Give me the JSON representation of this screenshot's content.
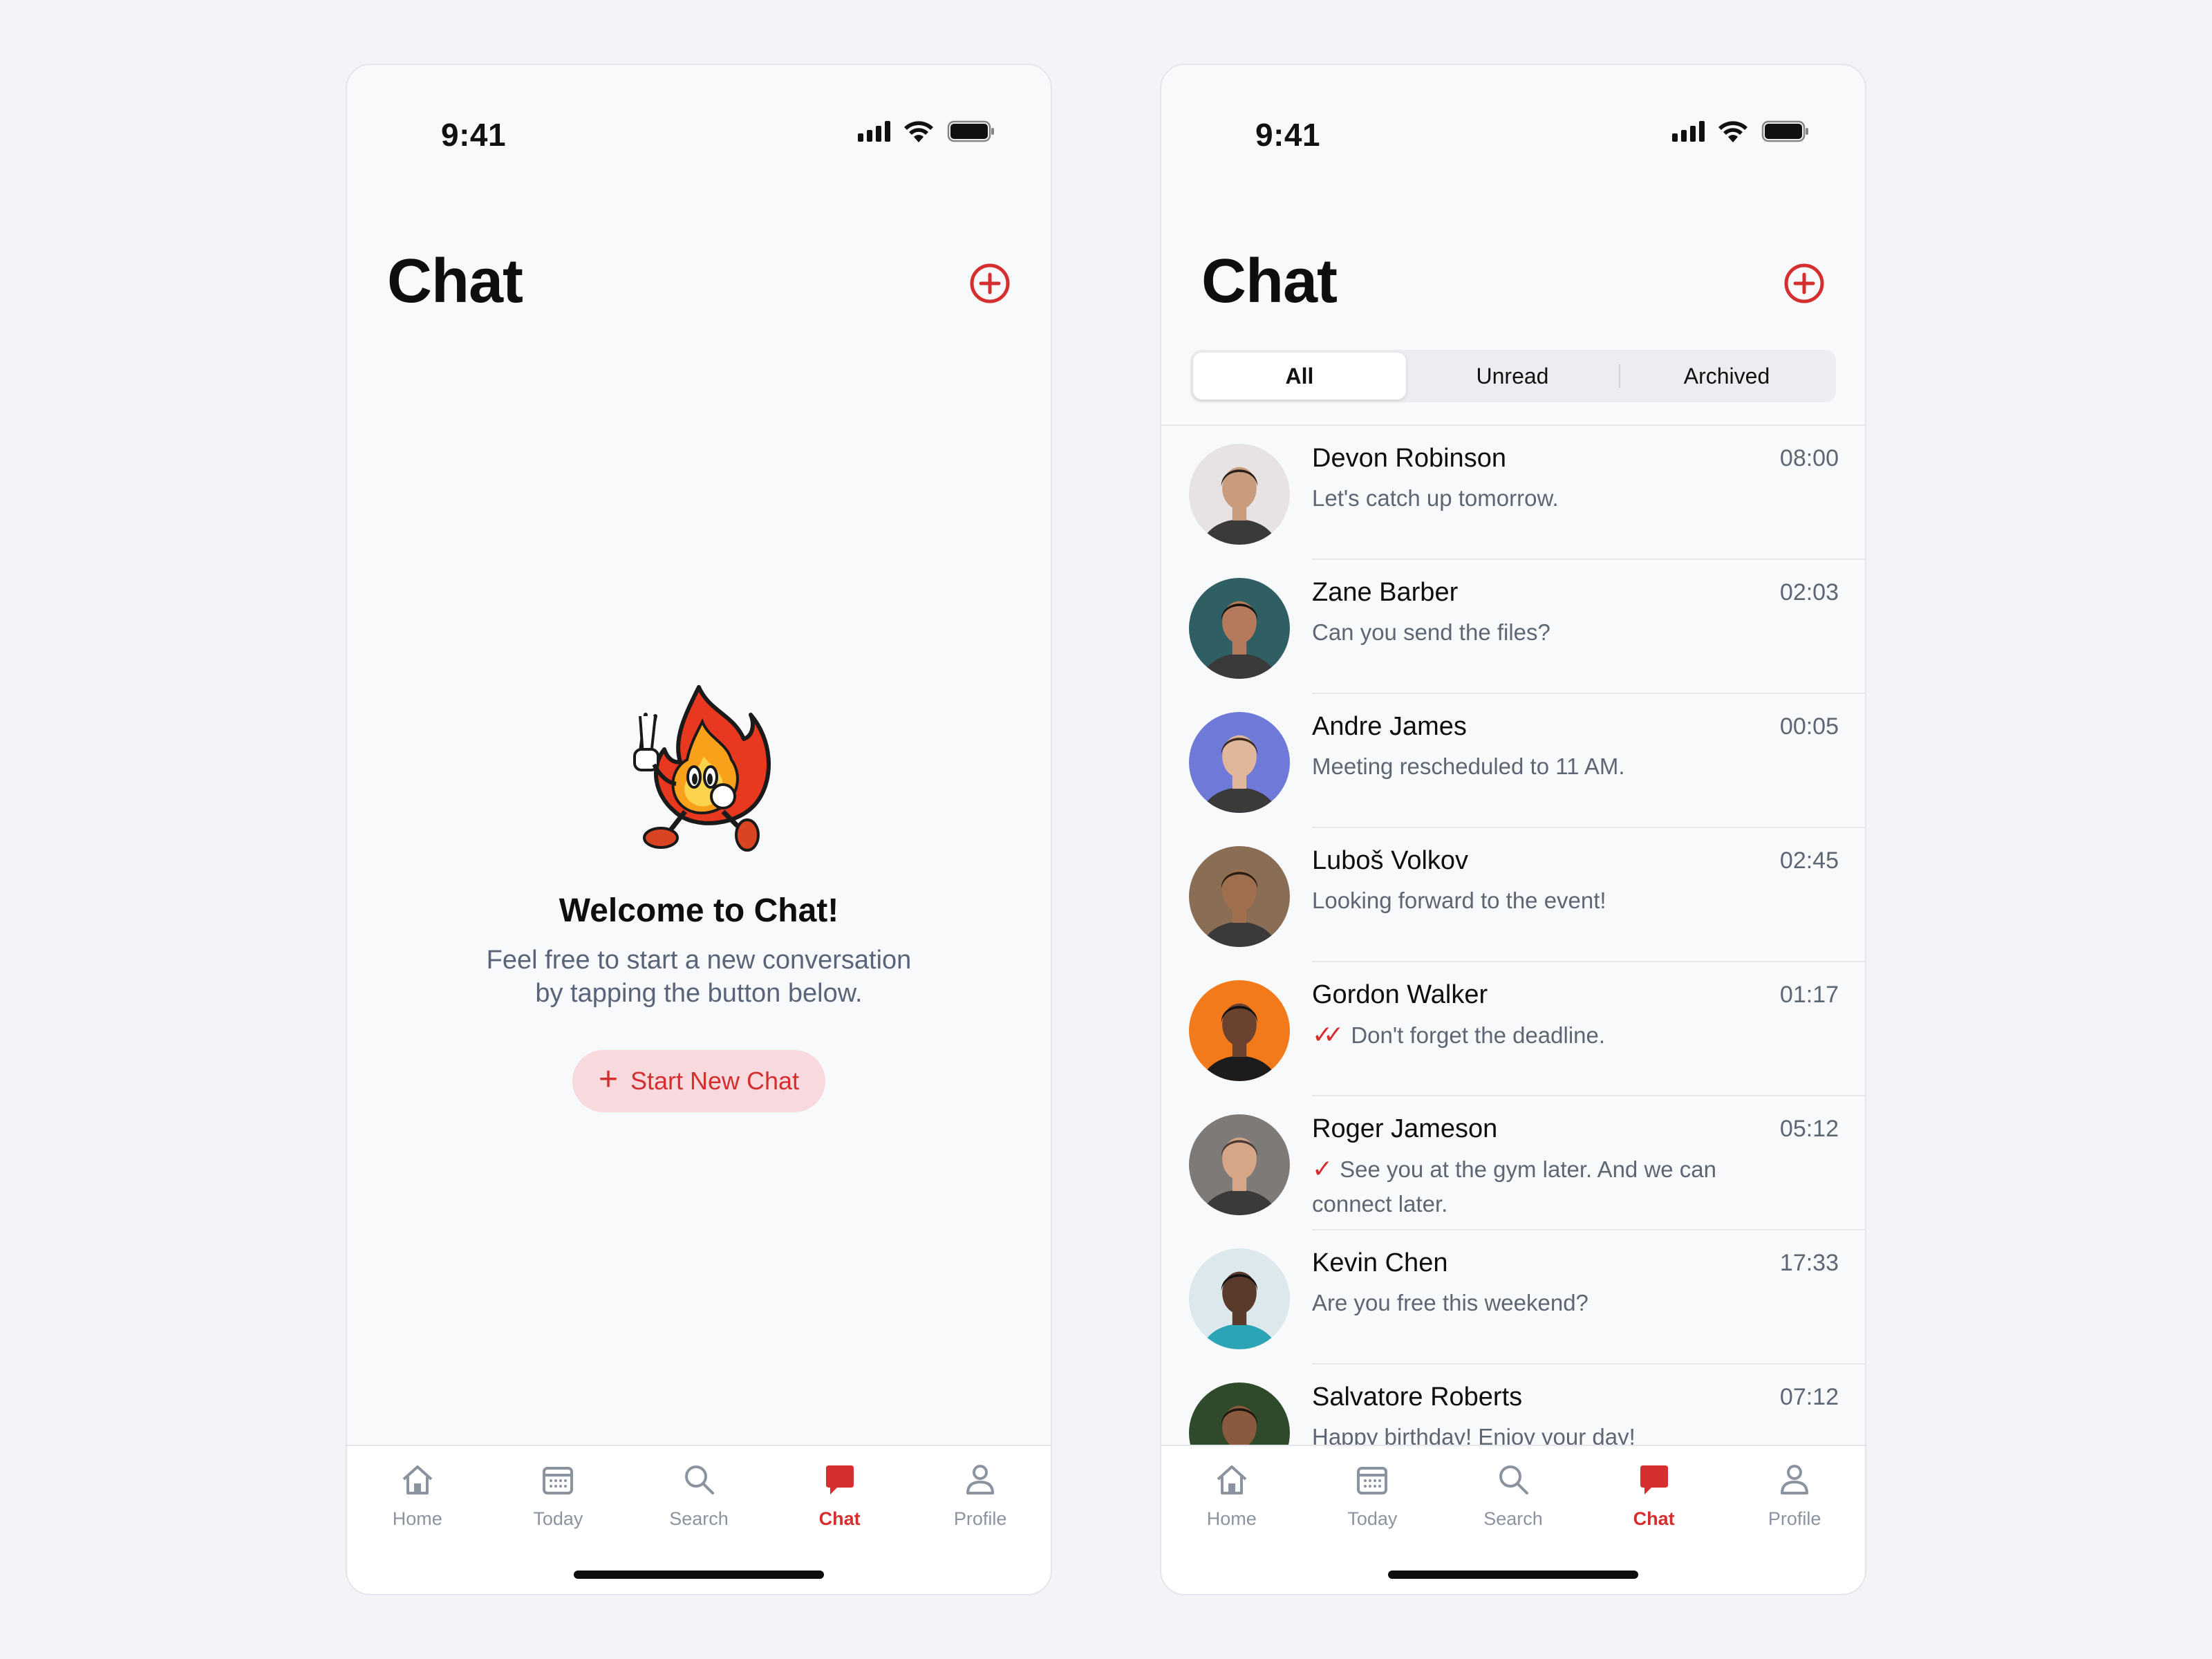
{
  "left_screen": {
    "status_time": "9:41",
    "title": "Chat",
    "empty_state": {
      "title": "Welcome to Chat!",
      "body_line1": "Feel free to start a new conversation",
      "body_line2": "by tapping the button below.",
      "button_label": "Start New Chat"
    }
  },
  "right_screen": {
    "status_time": "9:41",
    "title": "Chat",
    "filters": [
      "All",
      "Unread",
      "Archived"
    ],
    "active_filter": "All",
    "chats": [
      {
        "name": "Devon Robinson",
        "time": "08:00",
        "message": "Let's catch up tomorrow.",
        "status": "none",
        "avatar_bg": "#E7E2E3"
      },
      {
        "name": "Zane Barber",
        "time": "02:03",
        "message": "Can you send the files?",
        "status": "none",
        "avatar_bg": "#2F5E63"
      },
      {
        "name": "Andre James",
        "time": "00:05",
        "message": "Meeting rescheduled to 11 AM.",
        "status": "none",
        "avatar_bg": "#6E79D8"
      },
      {
        "name": "Luboš Volkov",
        "time": "02:45",
        "message": "Looking forward to the event!",
        "status": "none",
        "avatar_bg": "#8A6D55"
      },
      {
        "name": "Gordon Walker",
        "time": "01:17",
        "message": "Don't forget the deadline.",
        "status": "read",
        "avatar_bg": "#F27A1A"
      },
      {
        "name": "Roger Jameson",
        "time": "05:12",
        "message": "See you at the gym later. And we can connect later.",
        "status": "sent",
        "avatar_bg": "#7E7A78"
      },
      {
        "name": "Kevin Chen",
        "time": "17:33",
        "message": "Are you free this weekend?",
        "status": "none",
        "avatar_bg": "#DDE8EC"
      },
      {
        "name": "Salvatore Roberts",
        "time": "07:12",
        "message": "Happy birthday! Enjoy your day!",
        "status": "none",
        "avatar_bg": "#2E4A2A"
      }
    ]
  },
  "tab_bar": {
    "tabs": [
      {
        "label": "Home",
        "icon": "home-icon"
      },
      {
        "label": "Today",
        "icon": "calendar-icon"
      },
      {
        "label": "Search",
        "icon": "search-icon"
      },
      {
        "label": "Chat",
        "icon": "chat-bubble-icon"
      },
      {
        "label": "Profile",
        "icon": "profile-icon"
      }
    ],
    "active": "Chat"
  },
  "colors": {
    "accent": "#D42E2E",
    "background": "#F2F4F7",
    "screen": "#F8F9FB",
    "muted_text": "#5F6673",
    "button_tint": "#F8D9DD"
  }
}
